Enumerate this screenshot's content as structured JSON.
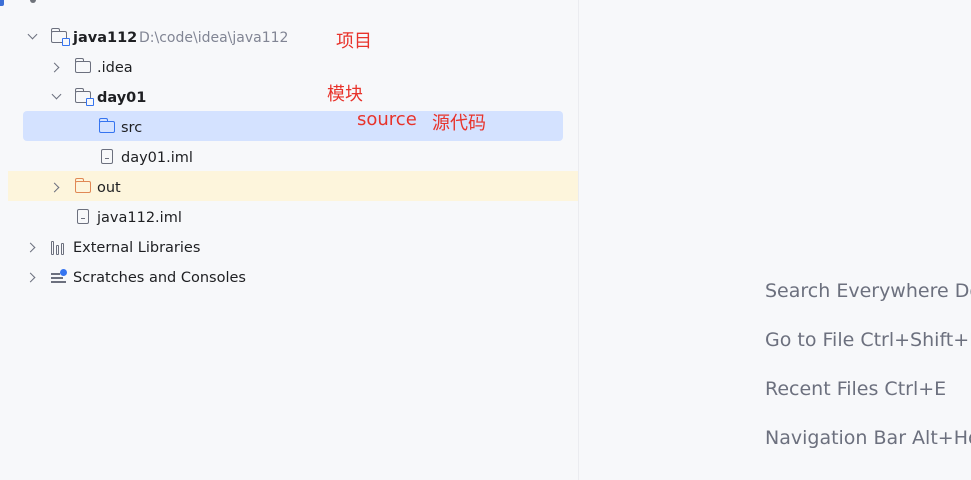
{
  "tree": {
    "root": {
      "name": "java112",
      "path": "D:\\code\\idea\\java112"
    },
    "idea": {
      "name": ".idea"
    },
    "module": {
      "name": "day01"
    },
    "src": {
      "name": "src"
    },
    "module_iml": {
      "name": "day01.iml"
    },
    "out": {
      "name": "out"
    },
    "project_iml": {
      "name": "java112.iml"
    },
    "external_libraries": {
      "name": "External Libraries"
    },
    "scratches": {
      "name": "Scratches and Consoles"
    }
  },
  "annotations": {
    "project": "项目",
    "module": "模块",
    "source": "source",
    "source_cn": "源代码"
  },
  "hints": [
    "Search Everywhere Do",
    "Go to File Ctrl+Shift+N",
    "Recent Files Ctrl+E",
    "Navigation Bar Alt+Ho"
  ],
  "colors": {
    "selection": "#d4e2ff",
    "highlight": "#fdf5dc",
    "annotation": "#e8332b",
    "folder_blue": "#3574f0",
    "folder_orange": "#e08855"
  },
  "icons": [
    "project-folder-icon",
    "folder-icon",
    "module-folder-icon",
    "source-folder-icon",
    "iml-file-icon",
    "excluded-folder-icon",
    "libraries-icon",
    "scratches-icon"
  ]
}
